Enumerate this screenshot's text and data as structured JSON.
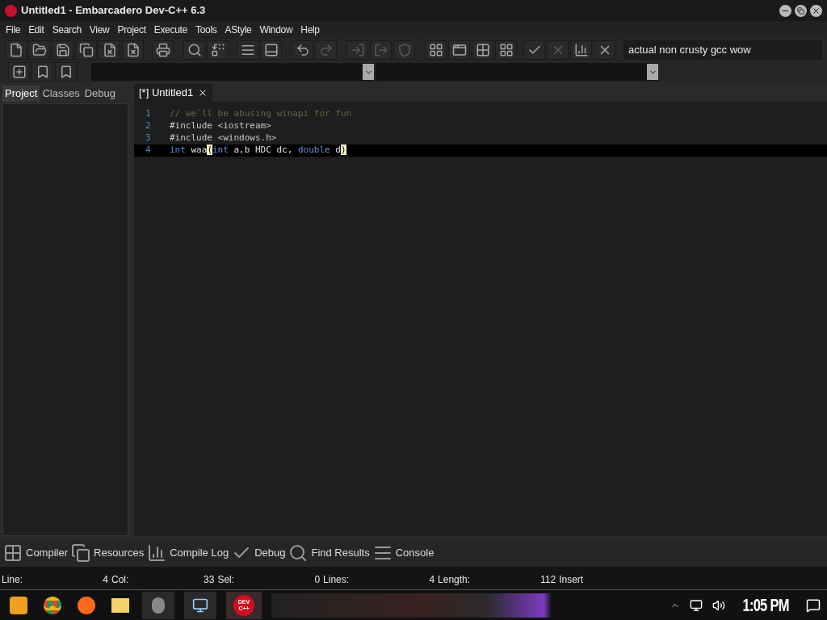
{
  "window": {
    "title": "Untitled1 - Embarcadero Dev-C++ 6.3"
  },
  "menu": [
    "File",
    "Edit",
    "Search",
    "View",
    "Project",
    "Execute",
    "Tools",
    "AStyle",
    "Window",
    "Help"
  ],
  "toolbar": {
    "compiler_set": "actual non crusty gcc wow"
  },
  "left_tabs": [
    {
      "label": "Project",
      "selected": true
    },
    {
      "label": "Classes",
      "selected": false
    },
    {
      "label": "Debug",
      "selected": false
    }
  ],
  "editor_tabs": [
    {
      "label": "[*] Untitled1",
      "selected": true
    }
  ],
  "code_lines": [
    {
      "number": "1",
      "current": false,
      "tokens": [
        {
          "kind": "comment",
          "text": "// we`ll be abusing winapi for fun"
        }
      ]
    },
    {
      "number": "2",
      "current": false,
      "tokens": [
        {
          "kind": "preprocessor",
          "text": "#include <iostream>"
        }
      ]
    },
    {
      "number": "3",
      "current": false,
      "tokens": [
        {
          "kind": "preprocessor",
          "text": "#include <windows.h>"
        }
      ]
    },
    {
      "number": "4",
      "current": true,
      "tokens": [
        {
          "kind": "keyword",
          "text": "int"
        },
        {
          "kind": "plain",
          "text": " waa"
        },
        {
          "kind": "bracket",
          "text": "("
        },
        {
          "kind": "keyword",
          "text": "int"
        },
        {
          "kind": "plain",
          "text": " a,b HDC dc, "
        },
        {
          "kind": "keyword",
          "text": "double"
        },
        {
          "kind": "plain",
          "text": " d"
        },
        {
          "kind": "bracket",
          "text": ")"
        }
      ]
    }
  ],
  "bottom_tabs": [
    {
      "kind": "grid",
      "label": "Compiler"
    },
    {
      "kind": "stack",
      "label": "Resources"
    },
    {
      "kind": "chart",
      "label": "Compile Log"
    },
    {
      "kind": "check",
      "label": "Debug"
    },
    {
      "kind": "find",
      "label": "Find Results"
    },
    {
      "kind": "console",
      "label": "Console"
    }
  ],
  "status_bar": [
    {
      "label": "Line:",
      "value": "4"
    },
    {
      "label": "Col:",
      "value": "33"
    },
    {
      "label": "Sel:",
      "value": "0"
    },
    {
      "label": "Lines:",
      "value": "4"
    },
    {
      "label": "Length:",
      "value": "112"
    },
    {
      "label": "Insert"
    }
  ],
  "taskbar": {
    "devcpp_icon_text": [
      "DEV",
      "C++"
    ],
    "time": "1:05 PM"
  }
}
